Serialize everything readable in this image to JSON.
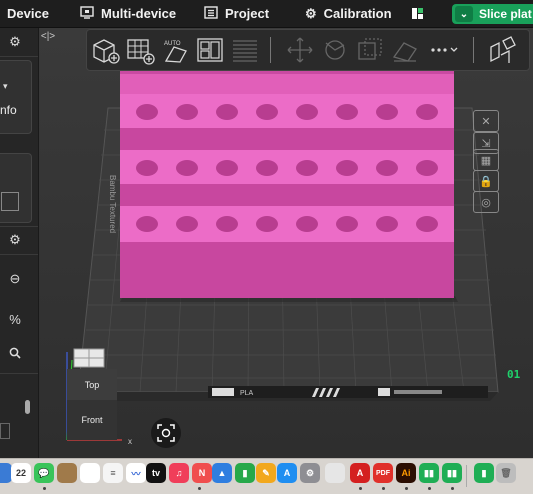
{
  "topbar": {
    "device": "Device",
    "multi_device": "Multi-device",
    "project": "Project",
    "calibration": "Calibration",
    "slice_button": "Slice plat"
  },
  "viewport": {
    "cube_top": "Top",
    "cube_front": "Front",
    "axis_x": "x",
    "plate_number": "01",
    "plate_label": "PLA"
  },
  "sidebar": {
    "info_label": "nfo"
  },
  "dock": {
    "calendar_day": "22",
    "pdf_label": "PDF",
    "ai_label": "Ai"
  },
  "colors": {
    "model_pink": "#e868c2",
    "slice_green": "#19a05a",
    "plate_dark": "#3f3f3f"
  }
}
